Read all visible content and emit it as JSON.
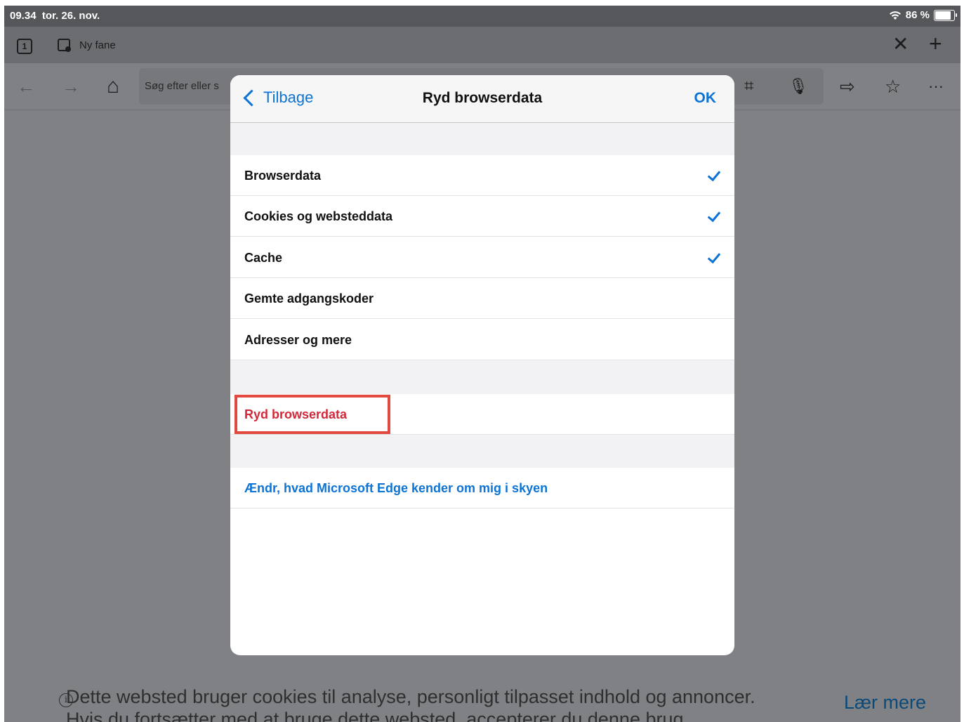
{
  "status_bar": {
    "time": "09.34",
    "date": "tor. 26. nov.",
    "battery_percent": "86 %",
    "battery_level": 0.86
  },
  "tab_strip": {
    "tab_count": "1",
    "tab_title": "Ny fane",
    "close_symbol": "✕",
    "add_symbol": "+"
  },
  "toolbar": {
    "back_symbol": "←",
    "forward_symbol": "→",
    "home_symbol": "⌂",
    "address_placeholder": "Søg efter eller s",
    "scan_symbol": "⌗",
    "mic_symbol": "🎙",
    "share_symbol": "⇨",
    "favorites_symbol": "☆",
    "more_symbol": "···"
  },
  "modal": {
    "back_label": "Tilbage",
    "title": "Ryd browserdata",
    "ok_label": "OK",
    "options": [
      {
        "label": "Browserdata",
        "checked": true
      },
      {
        "label": "Cookies og websteddata",
        "checked": true
      },
      {
        "label": "Cache",
        "checked": true
      },
      {
        "label": "Gemte adgangskoder",
        "checked": false
      },
      {
        "label": "Adresser og mere",
        "checked": false
      }
    ],
    "clear_action": "Ryd browserdata",
    "cloud_link": "Ændr, hvad Microsoft Edge kender om mig i skyen"
  },
  "page": {
    "info_symbol": "i",
    "cookie_notice_line1": "Dette websted bruger cookies til analyse, personligt tilpasset indhold og annoncer.",
    "cookie_notice_line2": "Hvis du fortsætter med at bruge dette websted, accepterer du denne brug.",
    "learn_more": "Lær mere"
  },
  "colors": {
    "accent": "#0d73d4",
    "danger": "#d2283a",
    "highlight": "#e24a3f"
  }
}
